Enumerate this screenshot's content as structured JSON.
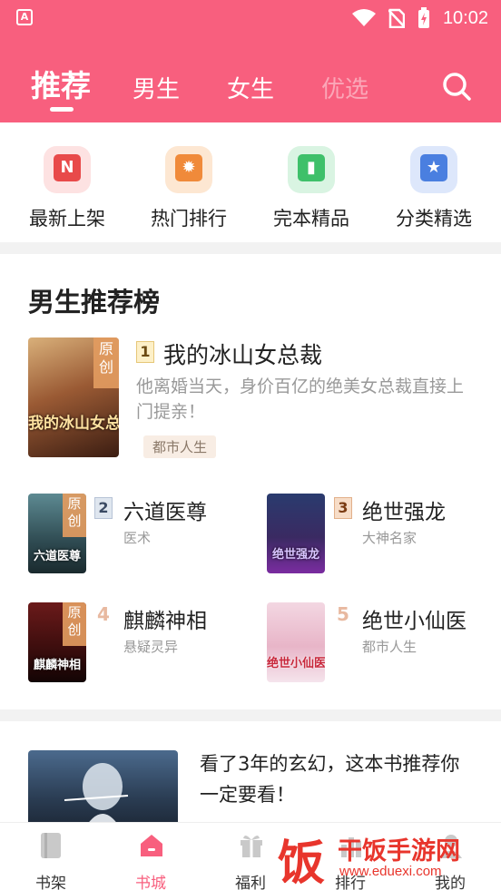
{
  "status_bar": {
    "time": "10:02",
    "app_icon_letter": "A"
  },
  "header": {
    "tabs": [
      {
        "label": "推荐",
        "active": true
      },
      {
        "label": "男生"
      },
      {
        "label": "女生"
      },
      {
        "label": "优选",
        "faded": true
      }
    ],
    "search_icon": "search-icon"
  },
  "quick_entries": [
    {
      "label": "最新上架",
      "icon": "new-shelf-icon",
      "icon_glyph": "N",
      "color": "#e84a4a"
    },
    {
      "label": "热门排行",
      "icon": "hot-rank-icon",
      "icon_glyph": "✹",
      "color": "#f08a3a"
    },
    {
      "label": "完本精品",
      "icon": "finished-book-icon",
      "icon_glyph": "▮",
      "color": "#3ec06a"
    },
    {
      "label": "分类精选",
      "icon": "category-star-icon",
      "icon_glyph": "★",
      "color": "#4a7fe0"
    }
  ],
  "ranking": {
    "title": "男生推荐榜",
    "top": {
      "rank": "1",
      "title": "我的冰山女总裁",
      "desc": "他离婚当天，身价百亿的绝美女总裁直接上门提亲！",
      "tag": "都市人生",
      "cover_text": "我的冰山女总裁",
      "cover_badge": "原创"
    },
    "items": [
      {
        "rank": "2",
        "title": "六道医尊",
        "category": "医术",
        "cover_text": "六道医尊",
        "cover_badge": "原创"
      },
      {
        "rank": "3",
        "title": "绝世强龙",
        "category": "大神名家",
        "cover_text": "绝世强龙",
        "cover_badge": ""
      },
      {
        "rank": "4",
        "title": "麒麟神相",
        "category": "悬疑灵异",
        "cover_text": "麒麟神相",
        "cover_badge": "原创"
      },
      {
        "rank": "5",
        "title": "绝世小仙医",
        "category": "都市人生",
        "cover_text": "绝世小仙医",
        "cover_badge": ""
      }
    ]
  },
  "article": {
    "text": "看了3年的玄幻，这本书推荐你一定要看！"
  },
  "bottom_nav": [
    {
      "label": "书架",
      "icon": "bookshelf-icon"
    },
    {
      "label": "书城",
      "icon": "home-icon",
      "active": true
    },
    {
      "label": "福利",
      "icon": "gift-icon"
    },
    {
      "label": "排行",
      "icon": "rank-icon"
    },
    {
      "label": "我的",
      "icon": "profile-icon"
    }
  ],
  "watermark": {
    "logo": "饭",
    "name": "干饭手游网",
    "url": "www.eduexi.com"
  },
  "colors": {
    "brand": "#f85f7e",
    "background": "#f2f2f2"
  }
}
